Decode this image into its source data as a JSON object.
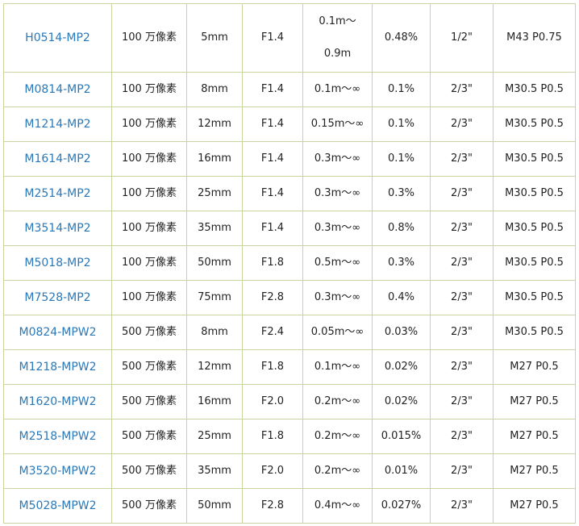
{
  "rows": [
    {
      "model": "H0514-MP2",
      "resolution": "100 万像素",
      "focal": "5mm",
      "aperture": "F1.4",
      "distance_line1": "0.1m～",
      "distance_line2": "0.9m",
      "distortion": "0.48%",
      "sensor": "1/2\"",
      "thread": "M43 P0.75"
    },
    {
      "model": "M0814-MP2",
      "resolution": "100 万像素",
      "focal": "8mm",
      "aperture": "F1.4",
      "distance": "0.1m～∞",
      "distortion": "0.1%",
      "sensor": "2/3\"",
      "thread": "M30.5 P0.5"
    },
    {
      "model": "M1214-MP2",
      "resolution": "100 万像素",
      "focal": "12mm",
      "aperture": "F1.4",
      "distance": "0.15m～∞",
      "distortion": "0.1%",
      "sensor": "2/3\"",
      "thread": "M30.5 P0.5"
    },
    {
      "model": "M1614-MP2",
      "resolution": "100 万像素",
      "focal": "16mm",
      "aperture": "F1.4",
      "distance": "0.3m～∞",
      "distortion": "0.1%",
      "sensor": "2/3\"",
      "thread": "M30.5 P0.5"
    },
    {
      "model": "M2514-MP2",
      "resolution": "100 万像素",
      "focal": "25mm",
      "aperture": "F1.4",
      "distance": "0.3m～∞",
      "distortion": "0.3%",
      "sensor": "2/3\"",
      "thread": "M30.5 P0.5"
    },
    {
      "model": "M3514-MP2",
      "resolution": "100 万像素",
      "focal": "35mm",
      "aperture": "F1.4",
      "distance": "0.3m～∞",
      "distortion": "0.8%",
      "sensor": "2/3\"",
      "thread": "M30.5 P0.5"
    },
    {
      "model": "M5018-MP2",
      "resolution": "100 万像素",
      "focal": "50mm",
      "aperture": "F1.8",
      "distance": "0.5m～∞",
      "distortion": "0.3%",
      "sensor": "2/3\"",
      "thread": "M30.5 P0.5"
    },
    {
      "model": "M7528-MP2",
      "resolution": "100 万像素",
      "focal": "75mm",
      "aperture": "F2.8",
      "distance": "0.3m～∞",
      "distortion": "0.4%",
      "sensor": "2/3\"",
      "thread": "M30.5 P0.5"
    },
    {
      "model": "M0824-MPW2",
      "resolution": "500 万像素",
      "focal": "8mm",
      "aperture": "F2.4",
      "distance": "0.05m～∞",
      "distortion": "0.03%",
      "sensor": "2/3\"",
      "thread": "M30.5 P0.5"
    },
    {
      "model": "M1218-MPW2",
      "resolution": "500 万像素",
      "focal": "12mm",
      "aperture": "F1.8",
      "distance": "0.1m～∞",
      "distortion": "0.02%",
      "sensor": "2/3\"",
      "thread": "M27 P0.5"
    },
    {
      "model": "M1620-MPW2",
      "resolution": "500 万像素",
      "focal": "16mm",
      "aperture": "F2.0",
      "distance": "0.2m～∞",
      "distortion": "0.02%",
      "sensor": "2/3\"",
      "thread": "M27 P0.5"
    },
    {
      "model": "M2518-MPW2",
      "resolution": "500 万像素",
      "focal": "25mm",
      "aperture": "F1.8",
      "distance": "0.2m～∞",
      "distortion": "0.015%",
      "sensor": "2/3\"",
      "thread": "M27 P0.5"
    },
    {
      "model": "M3520-MPW2",
      "resolution": "500 万像素",
      "focal": "35mm",
      "aperture": "F2.0",
      "distance": "0.2m～∞",
      "distortion": "0.01%",
      "sensor": "2/3\"",
      "thread": "M27 P0.5"
    },
    {
      "model": "M5028-MPW2",
      "resolution": "500 万像素",
      "focal": "50mm",
      "aperture": "F2.8",
      "distance": "0.4m～∞",
      "distortion": "0.027%",
      "sensor": "2/3\"",
      "thread": "M27 P0.5"
    }
  ],
  "colors": {
    "model_text": "#2a78b8",
    "body_text": "#222222",
    "grid_line": "#c8d4a0"
  }
}
